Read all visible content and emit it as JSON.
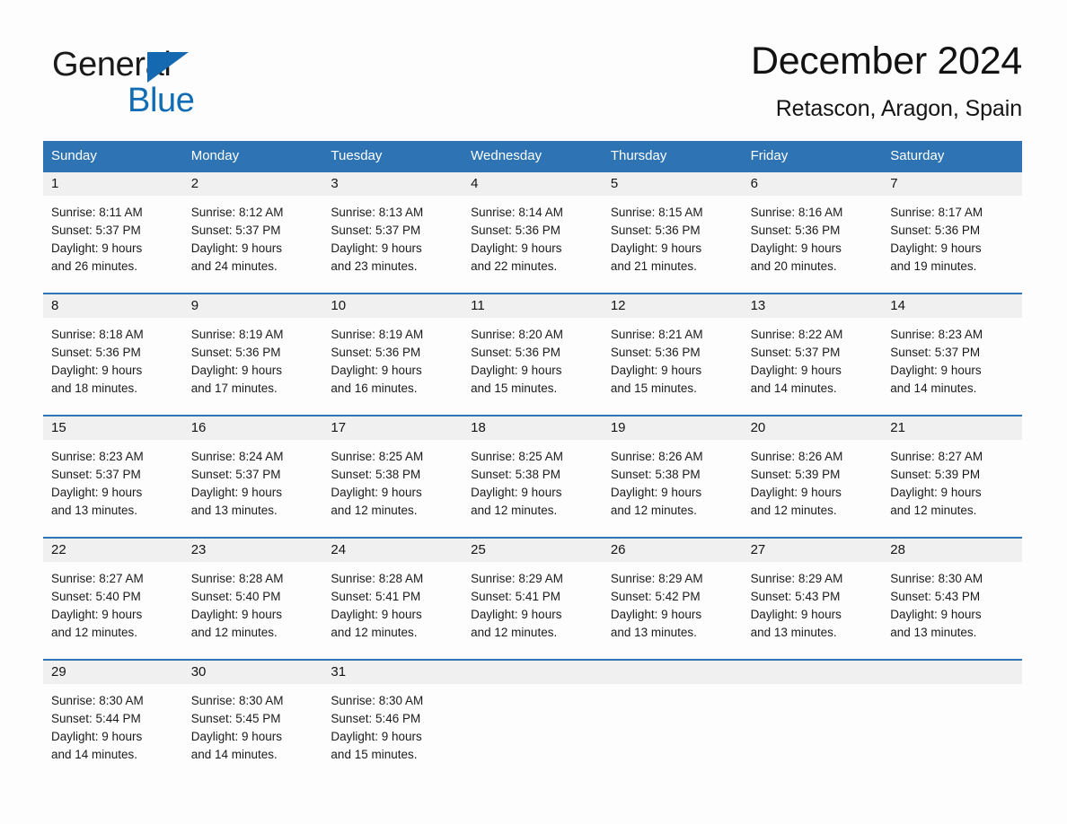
{
  "brand": {
    "name_part1": "General",
    "name_part2": "Blue",
    "triangle_color": "#1569b0",
    "blue_color": "#0f6cb5"
  },
  "header": {
    "title": "December 2024",
    "location": "Retascon, Aragon, Spain"
  },
  "theme": {
    "header_blue": "#2e74b5",
    "daynum_band": "#f0f0f0",
    "page_background": "#fdfdfd"
  },
  "weekdays": [
    "Sunday",
    "Monday",
    "Tuesday",
    "Wednesday",
    "Thursday",
    "Friday",
    "Saturday"
  ],
  "weeks": [
    {
      "days": [
        {
          "num": "1",
          "sunrise": "Sunrise: 8:11 AM",
          "sunset": "Sunset: 5:37 PM",
          "daylight1": "Daylight: 9 hours",
          "daylight2": "and 26 minutes."
        },
        {
          "num": "2",
          "sunrise": "Sunrise: 8:12 AM",
          "sunset": "Sunset: 5:37 PM",
          "daylight1": "Daylight: 9 hours",
          "daylight2": "and 24 minutes."
        },
        {
          "num": "3",
          "sunrise": "Sunrise: 8:13 AM",
          "sunset": "Sunset: 5:37 PM",
          "daylight1": "Daylight: 9 hours",
          "daylight2": "and 23 minutes."
        },
        {
          "num": "4",
          "sunrise": "Sunrise: 8:14 AM",
          "sunset": "Sunset: 5:36 PM",
          "daylight1": "Daylight: 9 hours",
          "daylight2": "and 22 minutes."
        },
        {
          "num": "5",
          "sunrise": "Sunrise: 8:15 AM",
          "sunset": "Sunset: 5:36 PM",
          "daylight1": "Daylight: 9 hours",
          "daylight2": "and 21 minutes."
        },
        {
          "num": "6",
          "sunrise": "Sunrise: 8:16 AM",
          "sunset": "Sunset: 5:36 PM",
          "daylight1": "Daylight: 9 hours",
          "daylight2": "and 20 minutes."
        },
        {
          "num": "7",
          "sunrise": "Sunrise: 8:17 AM",
          "sunset": "Sunset: 5:36 PM",
          "daylight1": "Daylight: 9 hours",
          "daylight2": "and 19 minutes."
        }
      ]
    },
    {
      "days": [
        {
          "num": "8",
          "sunrise": "Sunrise: 8:18 AM",
          "sunset": "Sunset: 5:36 PM",
          "daylight1": "Daylight: 9 hours",
          "daylight2": "and 18 minutes."
        },
        {
          "num": "9",
          "sunrise": "Sunrise: 8:19 AM",
          "sunset": "Sunset: 5:36 PM",
          "daylight1": "Daylight: 9 hours",
          "daylight2": "and 17 minutes."
        },
        {
          "num": "10",
          "sunrise": "Sunrise: 8:19 AM",
          "sunset": "Sunset: 5:36 PM",
          "daylight1": "Daylight: 9 hours",
          "daylight2": "and 16 minutes."
        },
        {
          "num": "11",
          "sunrise": "Sunrise: 8:20 AM",
          "sunset": "Sunset: 5:36 PM",
          "daylight1": "Daylight: 9 hours",
          "daylight2": "and 15 minutes."
        },
        {
          "num": "12",
          "sunrise": "Sunrise: 8:21 AM",
          "sunset": "Sunset: 5:36 PM",
          "daylight1": "Daylight: 9 hours",
          "daylight2": "and 15 minutes."
        },
        {
          "num": "13",
          "sunrise": "Sunrise: 8:22 AM",
          "sunset": "Sunset: 5:37 PM",
          "daylight1": "Daylight: 9 hours",
          "daylight2": "and 14 minutes."
        },
        {
          "num": "14",
          "sunrise": "Sunrise: 8:23 AM",
          "sunset": "Sunset: 5:37 PM",
          "daylight1": "Daylight: 9 hours",
          "daylight2": "and 14 minutes."
        }
      ]
    },
    {
      "days": [
        {
          "num": "15",
          "sunrise": "Sunrise: 8:23 AM",
          "sunset": "Sunset: 5:37 PM",
          "daylight1": "Daylight: 9 hours",
          "daylight2": "and 13 minutes."
        },
        {
          "num": "16",
          "sunrise": "Sunrise: 8:24 AM",
          "sunset": "Sunset: 5:37 PM",
          "daylight1": "Daylight: 9 hours",
          "daylight2": "and 13 minutes."
        },
        {
          "num": "17",
          "sunrise": "Sunrise: 8:25 AM",
          "sunset": "Sunset: 5:38 PM",
          "daylight1": "Daylight: 9 hours",
          "daylight2": "and 12 minutes."
        },
        {
          "num": "18",
          "sunrise": "Sunrise: 8:25 AM",
          "sunset": "Sunset: 5:38 PM",
          "daylight1": "Daylight: 9 hours",
          "daylight2": "and 12 minutes."
        },
        {
          "num": "19",
          "sunrise": "Sunrise: 8:26 AM",
          "sunset": "Sunset: 5:38 PM",
          "daylight1": "Daylight: 9 hours",
          "daylight2": "and 12 minutes."
        },
        {
          "num": "20",
          "sunrise": "Sunrise: 8:26 AM",
          "sunset": "Sunset: 5:39 PM",
          "daylight1": "Daylight: 9 hours",
          "daylight2": "and 12 minutes."
        },
        {
          "num": "21",
          "sunrise": "Sunrise: 8:27 AM",
          "sunset": "Sunset: 5:39 PM",
          "daylight1": "Daylight: 9 hours",
          "daylight2": "and 12 minutes."
        }
      ]
    },
    {
      "days": [
        {
          "num": "22",
          "sunrise": "Sunrise: 8:27 AM",
          "sunset": "Sunset: 5:40 PM",
          "daylight1": "Daylight: 9 hours",
          "daylight2": "and 12 minutes."
        },
        {
          "num": "23",
          "sunrise": "Sunrise: 8:28 AM",
          "sunset": "Sunset: 5:40 PM",
          "daylight1": "Daylight: 9 hours",
          "daylight2": "and 12 minutes."
        },
        {
          "num": "24",
          "sunrise": "Sunrise: 8:28 AM",
          "sunset": "Sunset: 5:41 PM",
          "daylight1": "Daylight: 9 hours",
          "daylight2": "and 12 minutes."
        },
        {
          "num": "25",
          "sunrise": "Sunrise: 8:29 AM",
          "sunset": "Sunset: 5:41 PM",
          "daylight1": "Daylight: 9 hours",
          "daylight2": "and 12 minutes."
        },
        {
          "num": "26",
          "sunrise": "Sunrise: 8:29 AM",
          "sunset": "Sunset: 5:42 PM",
          "daylight1": "Daylight: 9 hours",
          "daylight2": "and 13 minutes."
        },
        {
          "num": "27",
          "sunrise": "Sunrise: 8:29 AM",
          "sunset": "Sunset: 5:43 PM",
          "daylight1": "Daylight: 9 hours",
          "daylight2": "and 13 minutes."
        },
        {
          "num": "28",
          "sunrise": "Sunrise: 8:30 AM",
          "sunset": "Sunset: 5:43 PM",
          "daylight1": "Daylight: 9 hours",
          "daylight2": "and 13 minutes."
        }
      ]
    },
    {
      "days": [
        {
          "num": "29",
          "sunrise": "Sunrise: 8:30 AM",
          "sunset": "Sunset: 5:44 PM",
          "daylight1": "Daylight: 9 hours",
          "daylight2": "and 14 minutes."
        },
        {
          "num": "30",
          "sunrise": "Sunrise: 8:30 AM",
          "sunset": "Sunset: 5:45 PM",
          "daylight1": "Daylight: 9 hours",
          "daylight2": "and 14 minutes."
        },
        {
          "num": "31",
          "sunrise": "Sunrise: 8:30 AM",
          "sunset": "Sunset: 5:46 PM",
          "daylight1": "Daylight: 9 hours",
          "daylight2": "and 15 minutes."
        },
        {
          "num": "",
          "sunrise": "",
          "sunset": "",
          "daylight1": "",
          "daylight2": ""
        },
        {
          "num": "",
          "sunrise": "",
          "sunset": "",
          "daylight1": "",
          "daylight2": ""
        },
        {
          "num": "",
          "sunrise": "",
          "sunset": "",
          "daylight1": "",
          "daylight2": ""
        },
        {
          "num": "",
          "sunrise": "",
          "sunset": "",
          "daylight1": "",
          "daylight2": ""
        }
      ]
    }
  ]
}
